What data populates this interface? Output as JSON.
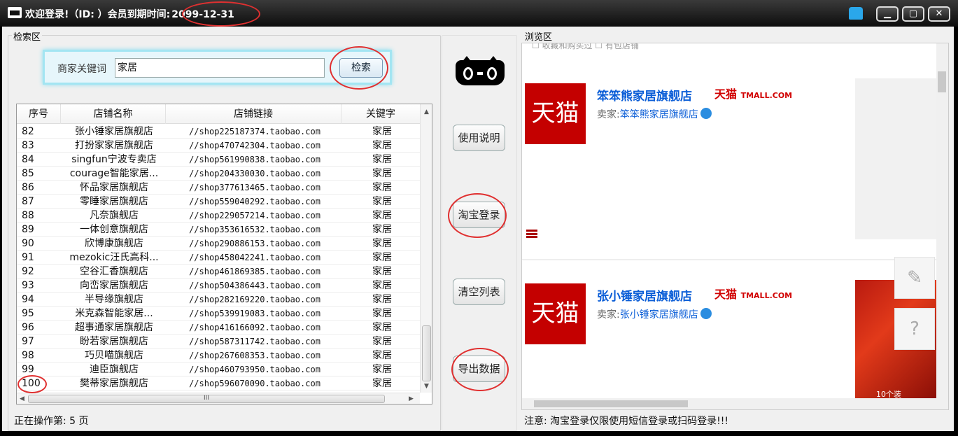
{
  "titlebar": {
    "title": "欢迎登录!（ID: ）会员到期时间:",
    "expiry": "2099-12-31",
    "minimize": "▁",
    "maximize": "▢",
    "close": "✕"
  },
  "search_panel": {
    "group_label": "检索区",
    "keyword_label": "商家关键词",
    "keyword_value": "家居",
    "search_button": "检索"
  },
  "table": {
    "columns": [
      "序号",
      "店铺名称",
      "店铺链接",
      "关键字"
    ],
    "rows": [
      {
        "no": "82",
        "name": "张小锤家居旗舰店",
        "link": "//shop225187374.taobao.com",
        "kw": "家居"
      },
      {
        "no": "83",
        "name": "打扮家家居旗舰店",
        "link": "//shop470742304.taobao.com",
        "kw": "家居"
      },
      {
        "no": "84",
        "name": "singfun宁波专卖店",
        "link": "//shop561990838.taobao.com",
        "kw": "家居"
      },
      {
        "no": "85",
        "name": "courage智能家居...",
        "link": "//shop204330030.taobao.com",
        "kw": "家居"
      },
      {
        "no": "86",
        "name": "怀品家居旗舰店",
        "link": "//shop377613465.taobao.com",
        "kw": "家居"
      },
      {
        "no": "87",
        "name": "零睡家居旗舰店",
        "link": "//shop559040292.taobao.com",
        "kw": "家居"
      },
      {
        "no": "88",
        "name": "凡奈旗舰店",
        "link": "//shop229057214.taobao.com",
        "kw": "家居"
      },
      {
        "no": "89",
        "name": "一体创意旗舰店",
        "link": "//shop353616532.taobao.com",
        "kw": "家居"
      },
      {
        "no": "90",
        "name": "欣博康旗舰店",
        "link": "//shop290886153.taobao.com",
        "kw": "家居"
      },
      {
        "no": "91",
        "name": "mezokic汪氏高科...",
        "link": "//shop458042241.taobao.com",
        "kw": "家居"
      },
      {
        "no": "92",
        "name": "空谷汇香旗舰店",
        "link": "//shop461869385.taobao.com",
        "kw": "家居"
      },
      {
        "no": "93",
        "name": "向峦家居旗舰店",
        "link": "//shop504386443.taobao.com",
        "kw": "家居"
      },
      {
        "no": "94",
        "name": "半导缘旗舰店",
        "link": "//shop282169220.taobao.com",
        "kw": "家居"
      },
      {
        "no": "95",
        "name": "米克森智能家居...",
        "link": "//shop539919083.taobao.com",
        "kw": "家居"
      },
      {
        "no": "96",
        "name": "超事通家居旗舰店",
        "link": "//shop416166092.taobao.com",
        "kw": "家居"
      },
      {
        "no": "97",
        "name": "盼若家居旗舰店",
        "link": "//shop587311742.taobao.com",
        "kw": "家居"
      },
      {
        "no": "98",
        "name": "巧贝喵旗舰店",
        "link": "//shop267608353.taobao.com",
        "kw": "家居"
      },
      {
        "no": "99",
        "name": "迪臣旗舰店",
        "link": "//shop460793950.taobao.com",
        "kw": "家居"
      },
      {
        "no": "100",
        "name": "樊蒂家居旗舰店",
        "link": "//shop596070090.taobao.com",
        "kw": "家居"
      }
    ],
    "hscroll_grip": "III"
  },
  "status_left": "正在操作第: 5 页",
  "side_buttons": {
    "help": "使用说明",
    "taobao_login": "淘宝登录",
    "clear_list": "清空列表",
    "export": "导出数据"
  },
  "browser_panel": {
    "group_label": "浏览区",
    "top_strip": "☐ 收藏和购买过  ☐ 有包店铺",
    "shops": [
      {
        "logo": "天猫",
        "name": "笨笨熊家居旗舰店",
        "tag": "天猫",
        "tag_suffix": "TMALL.COM",
        "seller_prefix": "卖家:",
        "seller": "笨笨熊家居旗舰店"
      },
      {
        "logo": "天猫",
        "name": "张小锤家居旗舰店",
        "tag": "天猫",
        "tag_suffix": "TMALL.COM",
        "seller_prefix": "卖家:",
        "seller": "张小锤家居旗舰店"
      }
    ],
    "promo_label": "10个装",
    "edit_icon": "✎",
    "help_icon": "?",
    "notice": "注意: 淘宝登录仅限使用短信登录或扫码登录!!!"
  },
  "colors": {
    "accent_red": "#e03030",
    "tmall_red": "#c40000",
    "link_blue": "#0b5ed7"
  }
}
